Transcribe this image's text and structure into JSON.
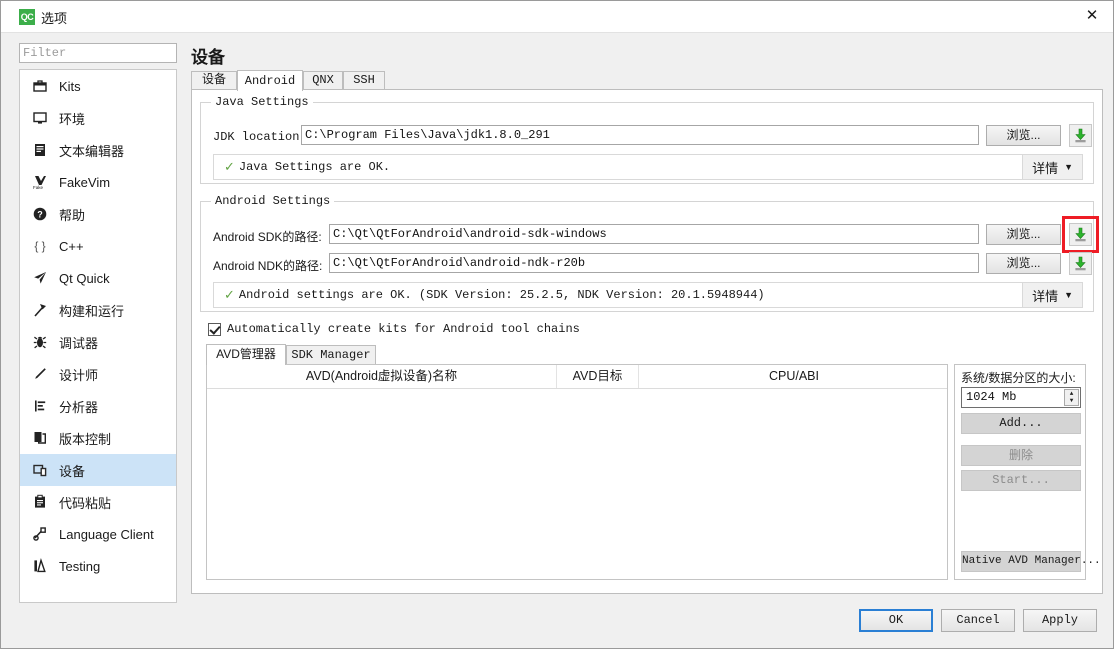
{
  "window": {
    "logo_text": "QC",
    "title": "选项",
    "close_icon": "close-icon"
  },
  "sidebar": {
    "filter_placeholder": "Filter",
    "filter_value": "",
    "items": [
      {
        "label": "Kits",
        "icon": "kits-icon",
        "selected": false
      },
      {
        "label": "环境",
        "icon": "monitor-icon",
        "selected": false
      },
      {
        "label": "文本编辑器",
        "icon": "text-editor-icon",
        "selected": false
      },
      {
        "label": "FakeVim",
        "icon": "fakevim-icon",
        "selected": false
      },
      {
        "label": "帮助",
        "icon": "help-icon",
        "selected": false
      },
      {
        "label": "C++",
        "icon": "braces-icon",
        "selected": false
      },
      {
        "label": "Qt Quick",
        "icon": "paper-plane-icon",
        "selected": false
      },
      {
        "label": "构建和运行",
        "icon": "hammer-icon",
        "selected": false
      },
      {
        "label": "调试器",
        "icon": "bug-icon",
        "selected": false
      },
      {
        "label": "设计师",
        "icon": "pencil-icon",
        "selected": false
      },
      {
        "label": "分析器",
        "icon": "analyzer-icon",
        "selected": false
      },
      {
        "label": "版本控制",
        "icon": "version-control-icon",
        "selected": false
      },
      {
        "label": "设备",
        "icon": "device-icon",
        "selected": true
      },
      {
        "label": "代码粘贴",
        "icon": "clipboard-icon",
        "selected": false
      },
      {
        "label": "Language Client",
        "icon": "language-client-icon",
        "selected": false
      },
      {
        "label": "Testing",
        "icon": "testing-icon",
        "selected": false
      }
    ]
  },
  "content": {
    "page_title": "设备",
    "tabs": [
      {
        "label": "设备",
        "active": false
      },
      {
        "label": "Android",
        "active": true
      },
      {
        "label": "QNX",
        "active": false
      },
      {
        "label": "SSH",
        "active": false
      }
    ]
  },
  "java_settings": {
    "group_title": "Java Settings",
    "jdk_label": "JDK location:",
    "jdk_value": "C:\\Program Files\\Java\\jdk1.8.0_291",
    "browse_label": "浏览...",
    "download_icon": "download-icon",
    "status_text": "Java Settings are OK.",
    "status_check_icon": "check-icon",
    "details_label": "详情",
    "details_caret_icon": "chevron-down-icon"
  },
  "android_settings": {
    "group_title": "Android Settings",
    "sdk_label": "Android SDK的路径:",
    "sdk_value": "C:\\Qt\\QtForAndroid\\android-sdk-windows",
    "ndk_label": "Android NDK的路径:",
    "ndk_value": "C:\\Qt\\QtForAndroid\\android-ndk-r20b",
    "browse_label": "浏览...",
    "download_icon": "download-icon",
    "highlight_color": "#ee1c25",
    "status_text": "Android settings are OK. (SDK Version: 25.2.5, NDK Version: 20.1.5948944)",
    "status_check_icon": "check-icon",
    "details_label": "详情",
    "details_caret_icon": "chevron-down-icon"
  },
  "auto_kits": {
    "label": "Automatically create kits for Android tool chains",
    "checked": true
  },
  "avd": {
    "tabs": [
      {
        "label": "AVD管理器",
        "active": true
      },
      {
        "label": "SDK Manager",
        "active": false
      }
    ],
    "columns": [
      "AVD(Android虚拟设备)名称",
      "AVD目标",
      "CPU/ABI"
    ],
    "rows": []
  },
  "avd_side": {
    "partition_label": "系统/数据分区的大小:",
    "partition_value": "1024 Mb",
    "add_label": "Add...",
    "delete_label": "删除",
    "start_label": "Start...",
    "native_manager_label": "Native AVD Manager..."
  },
  "footer": {
    "ok_label": "OK",
    "cancel_label": "Cancel",
    "apply_label": "Apply"
  }
}
